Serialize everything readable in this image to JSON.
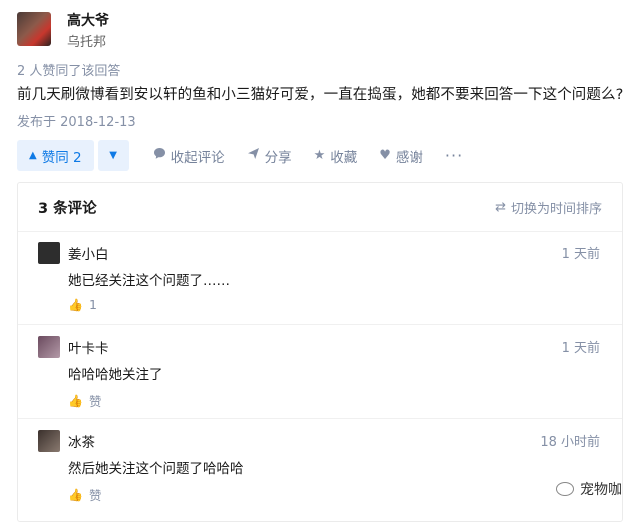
{
  "author": {
    "name": "高大爷",
    "bio": "乌托邦"
  },
  "answer": {
    "liked_by": "2 人赞同了该回答",
    "text": "前几天刷微博看到安以轩的鱼和小三猫好可爱，一直在捣蛋，她都不要来回答一下这个问题么?",
    "published": "发布于 2018-12-13"
  },
  "actions": {
    "vote_up": "赞同 2",
    "vote_up_icon": "▲",
    "vote_down_icon": "▼",
    "collapse_comments": "收起评论",
    "share": "分享",
    "favorite": "收藏",
    "thanks": "感谢",
    "more": "···"
  },
  "comments": {
    "count_label": "3 条评论",
    "sort_label": "切换为时间排序",
    "items": [
      {
        "name": "姜小白",
        "time": "1 天前",
        "text": "她已经关注这个问题了……",
        "likes": "1",
        "avatar_color": "#2d2d2d"
      },
      {
        "name": "叶卡卡",
        "time": "1 天前",
        "text": "哈哈哈她关注了",
        "likes": "赞",
        "avatar_color": "#7a5c6e"
      },
      {
        "name": "冰茶",
        "time": "18 小时前",
        "text": "然后她关注这个问题了哈哈哈",
        "likes": "赞",
        "avatar_color": "#5a4d48"
      }
    ]
  },
  "watermark": {
    "text": "宠物咖",
    "icon": "wechat-logo-icon"
  },
  "colors": {
    "accent": "#0f7ae5",
    "accent_bg": "#e8f1fd",
    "muted": "#8590a6"
  }
}
